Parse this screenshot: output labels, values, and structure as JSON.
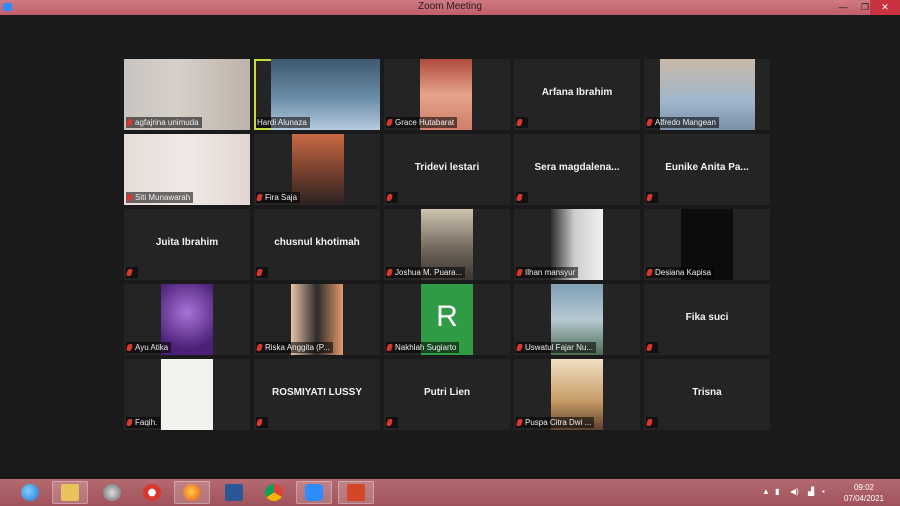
{
  "window": {
    "title": "Zoom Meeting",
    "minimize": "—",
    "restore": "❐",
    "close": "✕"
  },
  "participants": [
    {
      "name": "agfajrina unimuda",
      "video": true
    },
    {
      "name": "Hardi Alunaza",
      "video": true,
      "active": true
    },
    {
      "name": "Grace Hutabarat",
      "video": true
    },
    {
      "name": "Arfana Ibrahim",
      "display": "Arfana Ibrahim",
      "video": false
    },
    {
      "name": "Alfredo Mangean",
      "video": true
    },
    {
      "name": "Siti Munawarah",
      "video": true
    },
    {
      "name": "Fira Saja",
      "video": true
    },
    {
      "name": "Tridevi lestari",
      "display": "Tridevi lestari",
      "video": false
    },
    {
      "name": "Sera  magdalena...",
      "display": "Sera  magdalena...",
      "video": false
    },
    {
      "name": "Eunike Anita Pa...",
      "display": "Eunike  Anita  Pa...",
      "video": false
    },
    {
      "name": "Juita Ibrahim",
      "display": "Juita Ibrahim",
      "video": false
    },
    {
      "name": "chusnul khotimah",
      "display": "chusnul khotimah",
      "video": false
    },
    {
      "name": "Joshua M. Puara...",
      "video": true
    },
    {
      "name": "Ilhan mansyur",
      "video": true
    },
    {
      "name": "Desiana Kapisa",
      "video": true
    },
    {
      "name": "Ayu Atika",
      "video": true
    },
    {
      "name": "Riska Anggita (P...",
      "video": true
    },
    {
      "name": "Nakhlah Sugiarto",
      "video": true,
      "avatar_letter": "R"
    },
    {
      "name": "Uswatul Fajar Nu...",
      "video": true
    },
    {
      "name": "Fika suci",
      "display": "Fika suci",
      "video": false
    },
    {
      "name": "Faqih.",
      "video": true
    },
    {
      "name": "ROSMIYATI LUSSY",
      "display": "ROSMIYATI LUSSY",
      "video": false
    },
    {
      "name": "Putri Lien",
      "display": "Putri Lien",
      "video": false
    },
    {
      "name": "Puspa Citra Dwi ...",
      "video": true
    },
    {
      "name": "Trisna",
      "display": "Trisna",
      "video": false
    }
  ],
  "taskbar": {
    "apps": [
      "internet-explorer",
      "file-explorer",
      "app",
      "app",
      "firefox",
      "word",
      "chrome",
      "zoom",
      "powerpoint"
    ],
    "time": "09:02",
    "date": "07/04/2021"
  },
  "colors": {
    "active_speaker": "#c7dc3c",
    "muted": "#d9372b",
    "titlebar": "#c46670",
    "tile": "#242424"
  }
}
